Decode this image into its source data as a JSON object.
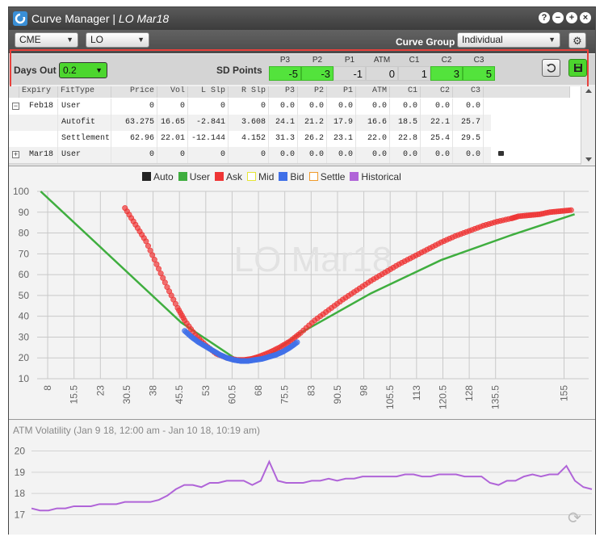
{
  "window": {
    "title_prefix": "Curve Manager | ",
    "title_italic": "LO Mar18",
    "controls": [
      "?",
      "−",
      "+",
      "×"
    ],
    "control_icons": [
      "help-icon",
      "minimize-icon",
      "maximize-icon",
      "close-icon"
    ]
  },
  "toolbar": {
    "exchange": "CME",
    "product": "LO",
    "curve_group_label": "Curve Group",
    "curve_group_value": "Individual",
    "settings_icon": "gear-icon"
  },
  "sd_panel": {
    "days_out_label": "Days Out",
    "days_out_value": "0.2",
    "sd_points_label": "SD Points",
    "columns": [
      "P3",
      "P2",
      "P1",
      "ATM",
      "C1",
      "C2",
      "C3"
    ],
    "values": [
      "-5",
      "-3",
      "-1",
      "0",
      "1",
      "3",
      "5"
    ],
    "highlighted": [
      true,
      true,
      false,
      false,
      false,
      true,
      true
    ],
    "reset_icon": "undo-icon",
    "save_icon": "save-icon",
    "highlight_color": "#e8413c",
    "green_color": "#53e33c"
  },
  "grid": {
    "headers": [
      "Expiry",
      "FitType",
      "Price",
      "Vol",
      "L Slp",
      "R Slp",
      "P3",
      "P2",
      "P1",
      "ATM",
      "C1",
      "C2",
      "C3"
    ],
    "rows": [
      {
        "toggle": "−",
        "cells": [
          "Feb18",
          "User",
          "0",
          "0",
          "0",
          "0",
          "0.0",
          "0.0",
          "0.0",
          "0.0",
          "0.0",
          "0.0",
          "0.0"
        ]
      },
      {
        "toggle": "",
        "cells": [
          "",
          "Autofit",
          "63.275",
          "16.65",
          "-2.841",
          "3.608",
          "24.1",
          "21.2",
          "17.9",
          "16.6",
          "18.5",
          "22.1",
          "25.7"
        ]
      },
      {
        "toggle": "",
        "cells": [
          "",
          "Settlement",
          "62.96",
          "22.01",
          "-12.144",
          "4.152",
          "31.3",
          "26.2",
          "23.1",
          "22.0",
          "22.8",
          "25.4",
          "29.5"
        ]
      },
      {
        "toggle": "+",
        "cells": [
          "Mar18",
          "User",
          "0",
          "0",
          "0",
          "0",
          "0.0",
          "0.0",
          "0.0",
          "0.0",
          "0.0",
          "0.0",
          "0.0"
        ]
      }
    ],
    "lock_icon": "lock-icon"
  },
  "chart_data": [
    {
      "type": "scatter",
      "watermark": "LO Mar18",
      "legend": [
        {
          "name": "Auto",
          "color": "#222222",
          "style": "filled"
        },
        {
          "name": "User",
          "color": "#3fae3f",
          "style": "filled"
        },
        {
          "name": "Ask",
          "color": "#ee3535",
          "style": "filled"
        },
        {
          "name": "Mid",
          "color": "#e6e635",
          "style": "outline"
        },
        {
          "name": "Bid",
          "color": "#3f6fe8",
          "style": "filled"
        },
        {
          "name": "Settle",
          "color": "#f09a2a",
          "style": "outline"
        },
        {
          "name": "Historical",
          "color": "#b064d8",
          "style": "filled"
        }
      ],
      "legend_placement": "top-center",
      "xlim": [
        5,
        162
      ],
      "ylim": [
        10,
        100
      ],
      "x_ticks": [
        "8",
        "15.5",
        "23",
        "30.5",
        "38",
        "45.5",
        "53",
        "60.5",
        "68",
        "75.5",
        "83",
        "90.5",
        "98",
        "105.5",
        "113",
        "120.5",
        "128",
        "135.5",
        "155"
      ],
      "y_ticks": [
        "10",
        "20",
        "30",
        "40",
        "50",
        "60",
        "70",
        "80",
        "90",
        "100"
      ],
      "grid": true,
      "series": [
        {
          "name": "User",
          "style": "line",
          "x": [
            6,
            46,
            62,
            70,
            80,
            100,
            120,
            140,
            158
          ],
          "y": [
            100,
            37,
            19,
            20,
            32,
            51,
            67,
            79,
            89
          ]
        },
        {
          "name": "Ask",
          "style": "points",
          "x": [
            30,
            33,
            36,
            39,
            42,
            45,
            47,
            50,
            53,
            56,
            59,
            62,
            64,
            66,
            68,
            71,
            74,
            77,
            80,
            84,
            88,
            92,
            96,
            100,
            104,
            108,
            112,
            116,
            120,
            124,
            128,
            132,
            136,
            140,
            142,
            145,
            148,
            151,
            154,
            157
          ],
          "y": [
            92,
            84,
            76,
            65,
            54,
            44,
            38,
            31,
            26,
            22,
            20,
            19,
            19,
            19.5,
            20.5,
            22.5,
            25,
            28,
            32,
            38,
            43,
            48,
            52.5,
            57,
            61,
            65,
            68.5,
            72,
            75.5,
            78.5,
            81,
            83.5,
            85.5,
            87,
            88,
            88.5,
            89,
            90,
            90.5,
            91
          ]
        },
        {
          "name": "Bid",
          "style": "points",
          "x": [
            47,
            49,
            51,
            53,
            55,
            57,
            59,
            61,
            63,
            65,
            67,
            69,
            71,
            73,
            75,
            77,
            79
          ],
          "y": [
            33,
            30,
            27.5,
            25.5,
            23.5,
            21.5,
            20,
            19,
            18.5,
            18.5,
            19,
            19.5,
            20.5,
            21.5,
            23,
            25,
            27.5
          ]
        }
      ]
    },
    {
      "type": "line",
      "title": "ATM Volatility (Jan 9 18, 12:00 am - Jan 10 18, 10:19 am)",
      "ylim": [
        16.6,
        20.4
      ],
      "y_ticks": [
        "17",
        "18",
        "19",
        "20"
      ],
      "grid": true,
      "series": [
        {
          "name": "Historical",
          "color": "#b064d8",
          "y": [
            17.3,
            17.2,
            17.2,
            17.3,
            17.3,
            17.4,
            17.4,
            17.4,
            17.5,
            17.5,
            17.5,
            17.6,
            17.6,
            17.6,
            17.6,
            17.7,
            17.9,
            18.2,
            18.4,
            18.4,
            18.3,
            18.5,
            18.5,
            18.6,
            18.6,
            18.6,
            18.4,
            18.6,
            19.5,
            18.6,
            18.5,
            18.5,
            18.5,
            18.6,
            18.6,
            18.7,
            18.6,
            18.7,
            18.7,
            18.8,
            18.8,
            18.8,
            18.8,
            18.8,
            18.9,
            18.9,
            18.8,
            18.8,
            18.9,
            18.9,
            18.9,
            18.8,
            18.8,
            18.8,
            18.5,
            18.4,
            18.6,
            18.6,
            18.8,
            18.9,
            18.8,
            18.9,
            18.9,
            19.3,
            18.6,
            18.3,
            18.2
          ]
        }
      ]
    }
  ]
}
